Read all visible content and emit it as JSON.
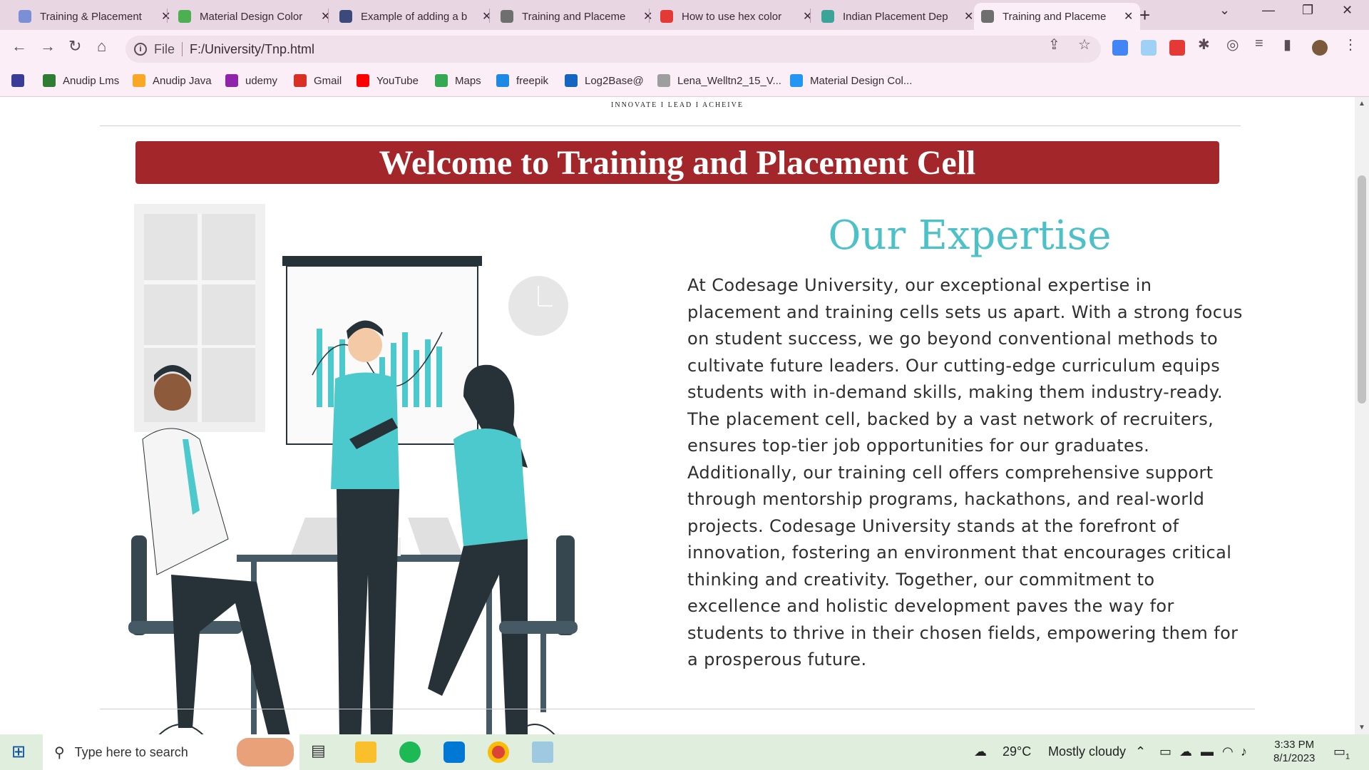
{
  "browser": {
    "tabs": [
      {
        "title": "Training & Placement",
        "fav_color": "#7b8fd6",
        "active": false
      },
      {
        "title": "Material Design Color",
        "fav_color": "#4caf50",
        "active": false
      },
      {
        "title": "Example of adding a b",
        "fav_color": "#3b4a7a",
        "active": false
      },
      {
        "title": "Training and Placeme",
        "fav_color": "#6f6f6f",
        "active": false
      },
      {
        "title": "How to use hex color",
        "fav_color": "#e53935",
        "active": false
      },
      {
        "title": "Indian Placement Dep",
        "fav_color": "#3aa39a",
        "active": false
      },
      {
        "title": "Training and Placeme",
        "fav_color": "#6f6f6f",
        "active": true
      }
    ],
    "address": {
      "scheme_label": "File",
      "url": "F:/University/Tnp.html"
    },
    "bookmarks": [
      {
        "label": "",
        "color": "#3b3b9a"
      },
      {
        "label": "Anudip Lms",
        "color": "#2e7d32"
      },
      {
        "label": "Anudip Java",
        "color": "#f9a825"
      },
      {
        "label": "udemy",
        "color": "#8e24aa"
      },
      {
        "label": "Gmail",
        "color": "#d93025"
      },
      {
        "label": "YouTube",
        "color": "#ff0000"
      },
      {
        "label": "Maps",
        "color": "#34a853"
      },
      {
        "label": "freepik",
        "color": "#1e88e5"
      },
      {
        "label": "Log2Base@",
        "color": "#1565c0"
      },
      {
        "label": "Lena_Welltn2_15_V...",
        "color": "#9e9e9e"
      },
      {
        "label": "Material Design Col...",
        "color": "#2196f3"
      }
    ]
  },
  "page": {
    "tagline": "INNOVATE I LEAD I ACHEIVE",
    "banner": "Welcome to Training and Placement Cell",
    "heading": "Our Expertise",
    "paragraph": "At Codesage University, our exceptional expertise in placement and training cells sets us apart. With a strong focus on student success, we go beyond conventional methods to cultivate future leaders. Our cutting-edge curriculum equips students with in-demand skills, making them industry-ready. The placement cell, backed by a vast network of recruiters, ensures top-tier job opportunities for our graduates. Additionally, our training cell offers comprehensive support through mentorship programs, hackathons, and real-world projects. Codesage University stands at the forefront of innovation, fostering an environment that encourages critical thinking and creativity. Together, our commitment to excellence and holistic development paves the way for students to thrive in their chosen fields, empowering them for a prosperous future.",
    "colors": {
      "banner": "#a3262a",
      "heading": "#4cc1c8",
      "illustration_accent": "#4cc9cc"
    }
  },
  "taskbar": {
    "search_placeholder": "Type here to search",
    "weather_temp": "29°C",
    "weather_text": "Mostly cloudy",
    "time": "3:33 PM",
    "date": "8/1/2023",
    "notification_count": "1"
  }
}
